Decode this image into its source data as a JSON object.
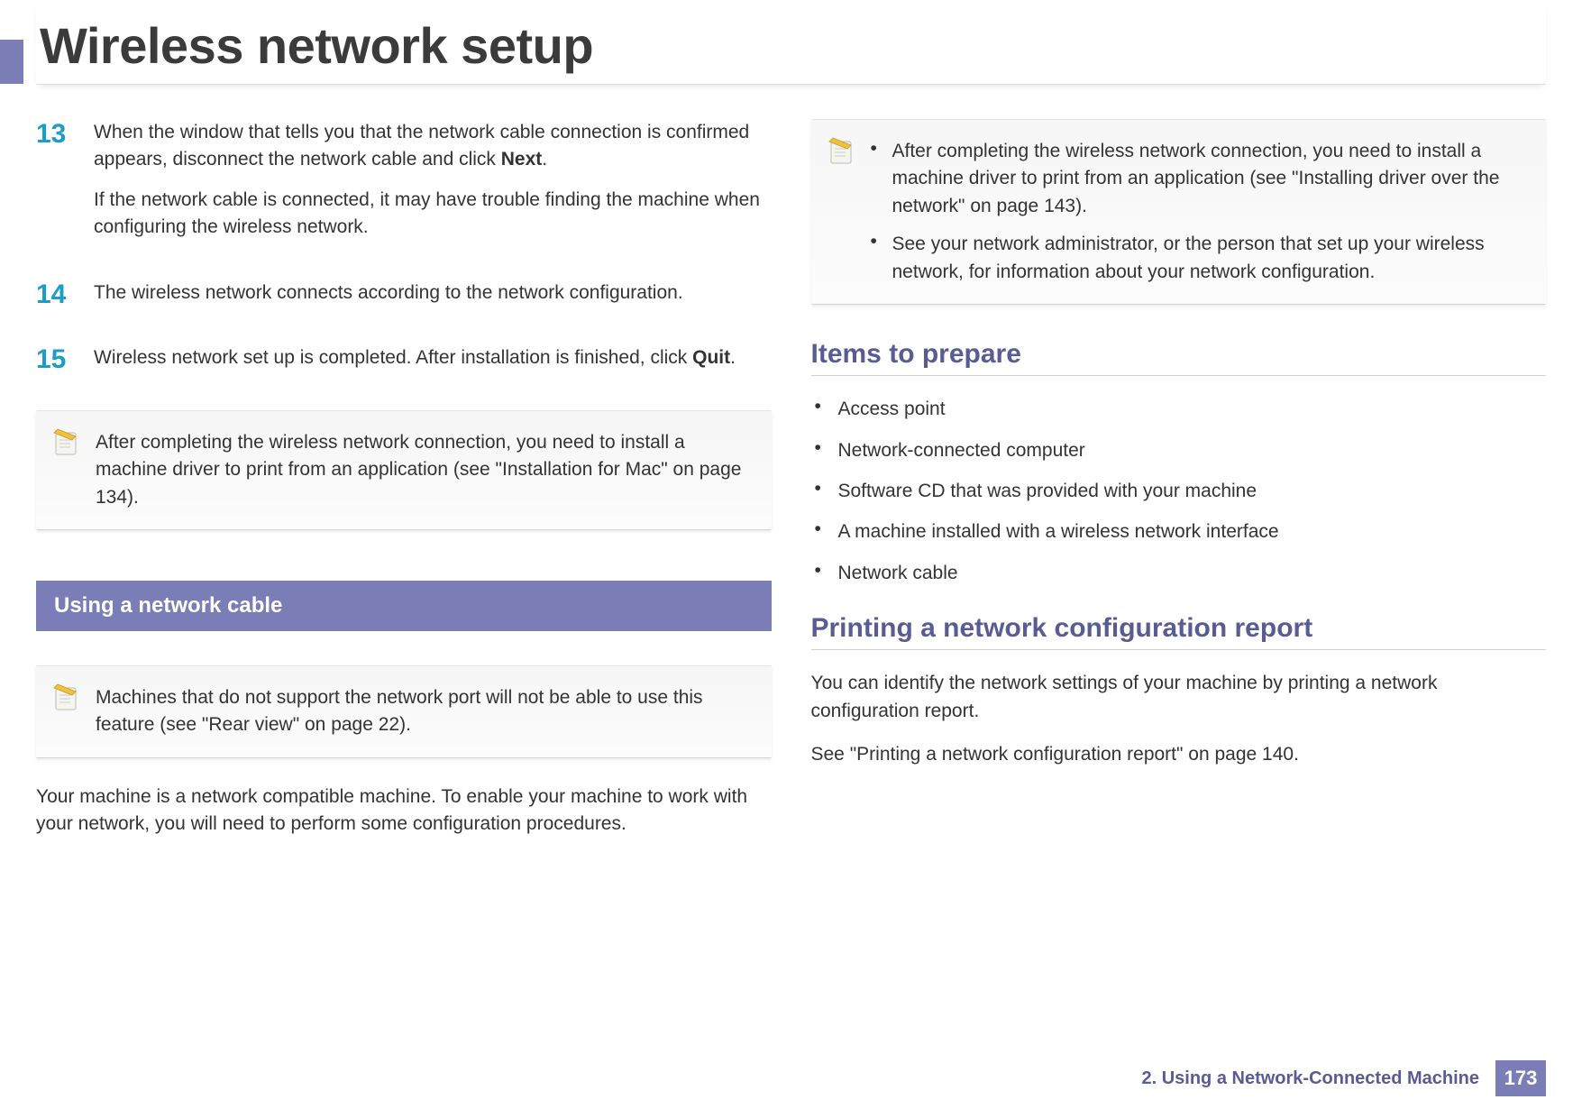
{
  "page_title": "Wireless network setup",
  "left": {
    "steps": [
      {
        "num": "13",
        "paragraphs": [
          "When the window that tells you that the network cable connection is confirmed appears, disconnect the network cable and click <b>Next</b>.",
          "If the network cable is connected, it may have trouble finding the machine when configuring the wireless network."
        ]
      },
      {
        "num": "14",
        "paragraphs": [
          "The wireless network connects according to the network configuration."
        ]
      },
      {
        "num": "15",
        "paragraphs": [
          "Wireless network set up is completed. After installation is finished, click <b>Quit</b>."
        ]
      }
    ],
    "note1": "After completing the wireless network connection, you need to install a machine driver to print from an application (see \"Installation for Mac\" on page 134).",
    "section_bar": "Using a network cable",
    "note2": "Machines that do not support the network port will not be able to use this feature (see \"Rear view\" on page 22).",
    "body": "Your machine is a network compatible machine. To enable your machine to work with your network, you will need to perform some configuration procedures."
  },
  "right": {
    "note_bullets": [
      "After completing the wireless network connection, you need to install a machine driver to print from an application (see \"Installing driver over the network\" on page 143).",
      "See your network administrator, or the person that set up your wireless network, for information about your network configuration."
    ],
    "subhead1": "Items to prepare",
    "items": [
      "Access point",
      "Network-connected computer",
      "Software CD that was provided with your machine",
      "A machine installed with a wireless network interface",
      "Network cable"
    ],
    "subhead2": "Printing a network configuration report",
    "p1": "You can identify the network settings of your machine by printing a network configuration report.",
    "p2": "See \"Printing a network configuration report\" on page 140."
  },
  "footer": {
    "chapter": "2.  Using a Network-Connected Machine",
    "page": "173"
  }
}
